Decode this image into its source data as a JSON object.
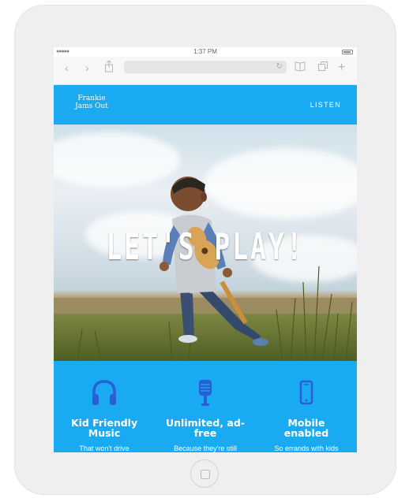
{
  "status_bar": {
    "time": "1:37 PM"
  },
  "site": {
    "logo_line1": "Frankie",
    "logo_line2": "Jams Out",
    "nav_listen": "LISTEN"
  },
  "hero": {
    "title": "LET'S PLAY!"
  },
  "features": [
    {
      "icon": "headphones-icon",
      "title_line1": "Kid Friendly",
      "title_line2": "Music",
      "text": "That won't drive"
    },
    {
      "icon": "microphone-icon",
      "title_line1": "Unlimited, ad-",
      "title_line2": "free",
      "text": "Because they're still"
    },
    {
      "icon": "mobile-phone-icon",
      "title_line1": "Mobile",
      "title_line2": "enabled",
      "text": "So errands with kids"
    }
  ],
  "colors": {
    "brand_blue": "#1aaaf2",
    "icon_blue": "#2a5fd6"
  }
}
